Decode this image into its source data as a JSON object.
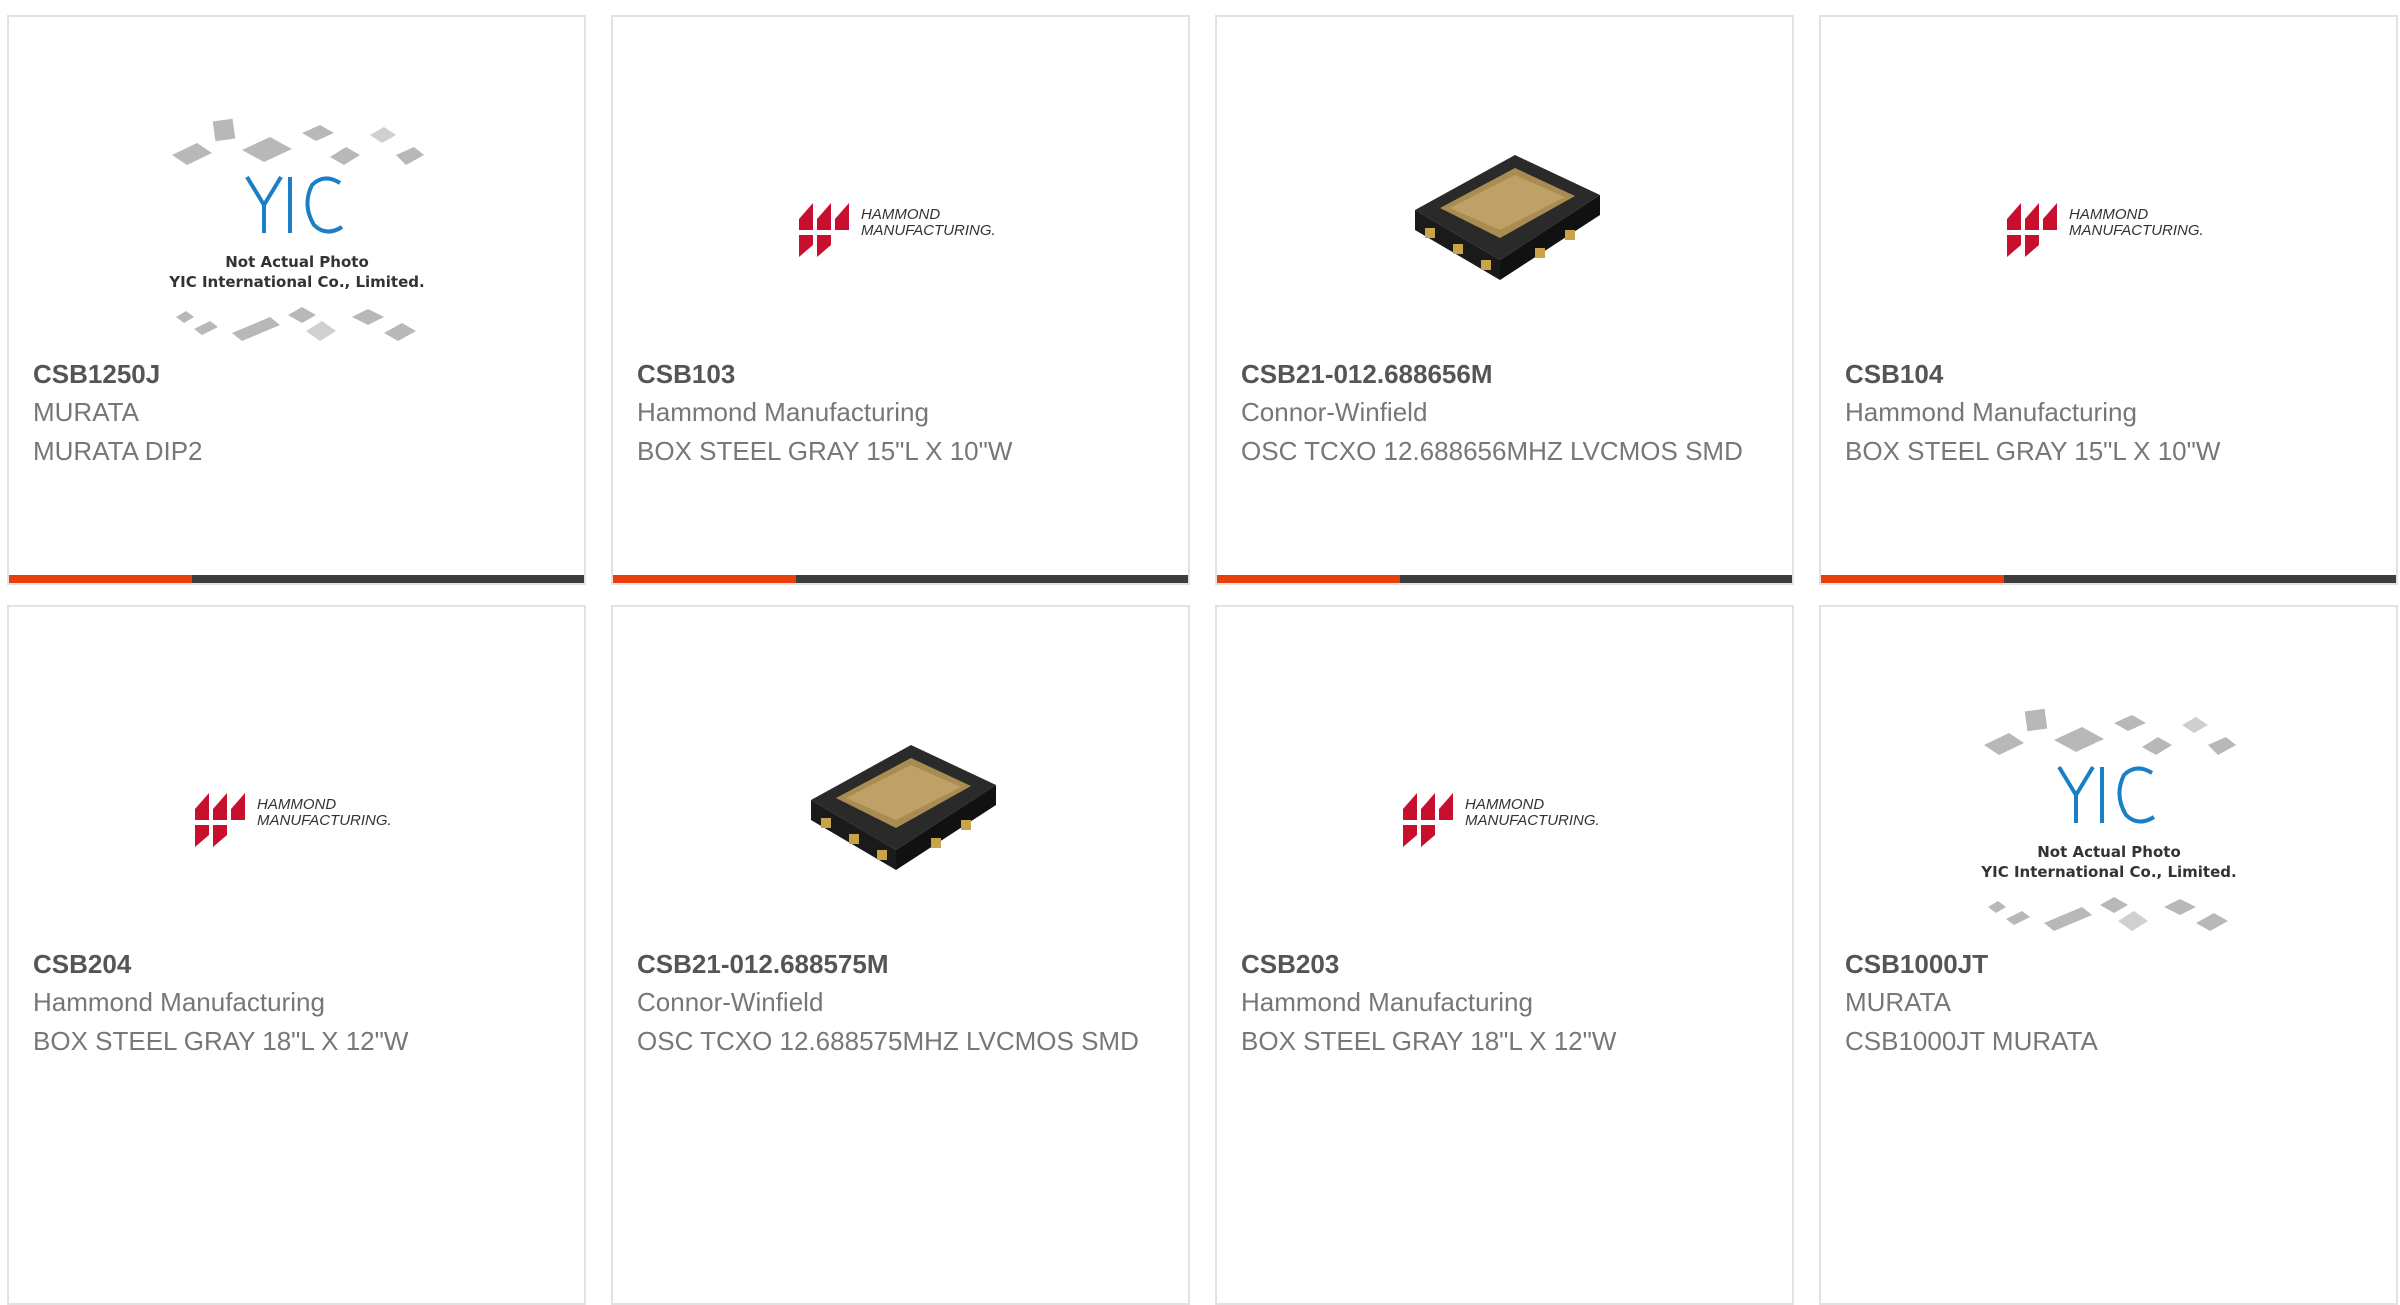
{
  "products": [
    {
      "part": "CSB1250J",
      "maker": "MURATA",
      "desc": "MURATA DIP2",
      "image": "yic-placeholder"
    },
    {
      "part": "CSB103",
      "maker": "Hammond Manufacturing",
      "desc": "BOX STEEL GRAY 15\"L X 10\"W",
      "image": "hammond-logo"
    },
    {
      "part": "CSB21-012.688656M",
      "maker": "Connor-Winfield",
      "desc": "OSC TCXO 12.688656MHZ LVCMOS SMD",
      "image": "oscillator-chip"
    },
    {
      "part": "CSB104",
      "maker": "Hammond Manufacturing",
      "desc": "BOX STEEL GRAY 15\"L X 10\"W",
      "image": "hammond-logo"
    },
    {
      "part": "CSB204",
      "maker": "Hammond Manufacturing",
      "desc": "BOX STEEL GRAY 18\"L X 12\"W",
      "image": "hammond-logo"
    },
    {
      "part": "CSB21-012.688575M",
      "maker": "Connor-Winfield",
      "desc": "OSC TCXO 12.688575MHZ LVCMOS SMD",
      "image": "oscillator-chip"
    },
    {
      "part": "CSB203",
      "maker": "Hammond Manufacturing",
      "desc": "BOX STEEL GRAY 18\"L X 12\"W",
      "image": "hammond-logo"
    },
    {
      "part": "CSB1000JT",
      "maker": "MURATA",
      "desc": "CSB1000JT MURATA",
      "image": "yic-placeholder"
    }
  ],
  "placeholder": {
    "brand": "YIC",
    "line1": "Not Actual Photo",
    "line2": "YIC International Co., Limited."
  },
  "hammond": {
    "line1": "HAMMOND",
    "line2": "MANUFACTURING."
  },
  "colors": {
    "accent": "#e8400c",
    "bar": "#3d3d3d",
    "hammond_red": "#c8102e",
    "yic_blue": "#1a7fc4"
  }
}
